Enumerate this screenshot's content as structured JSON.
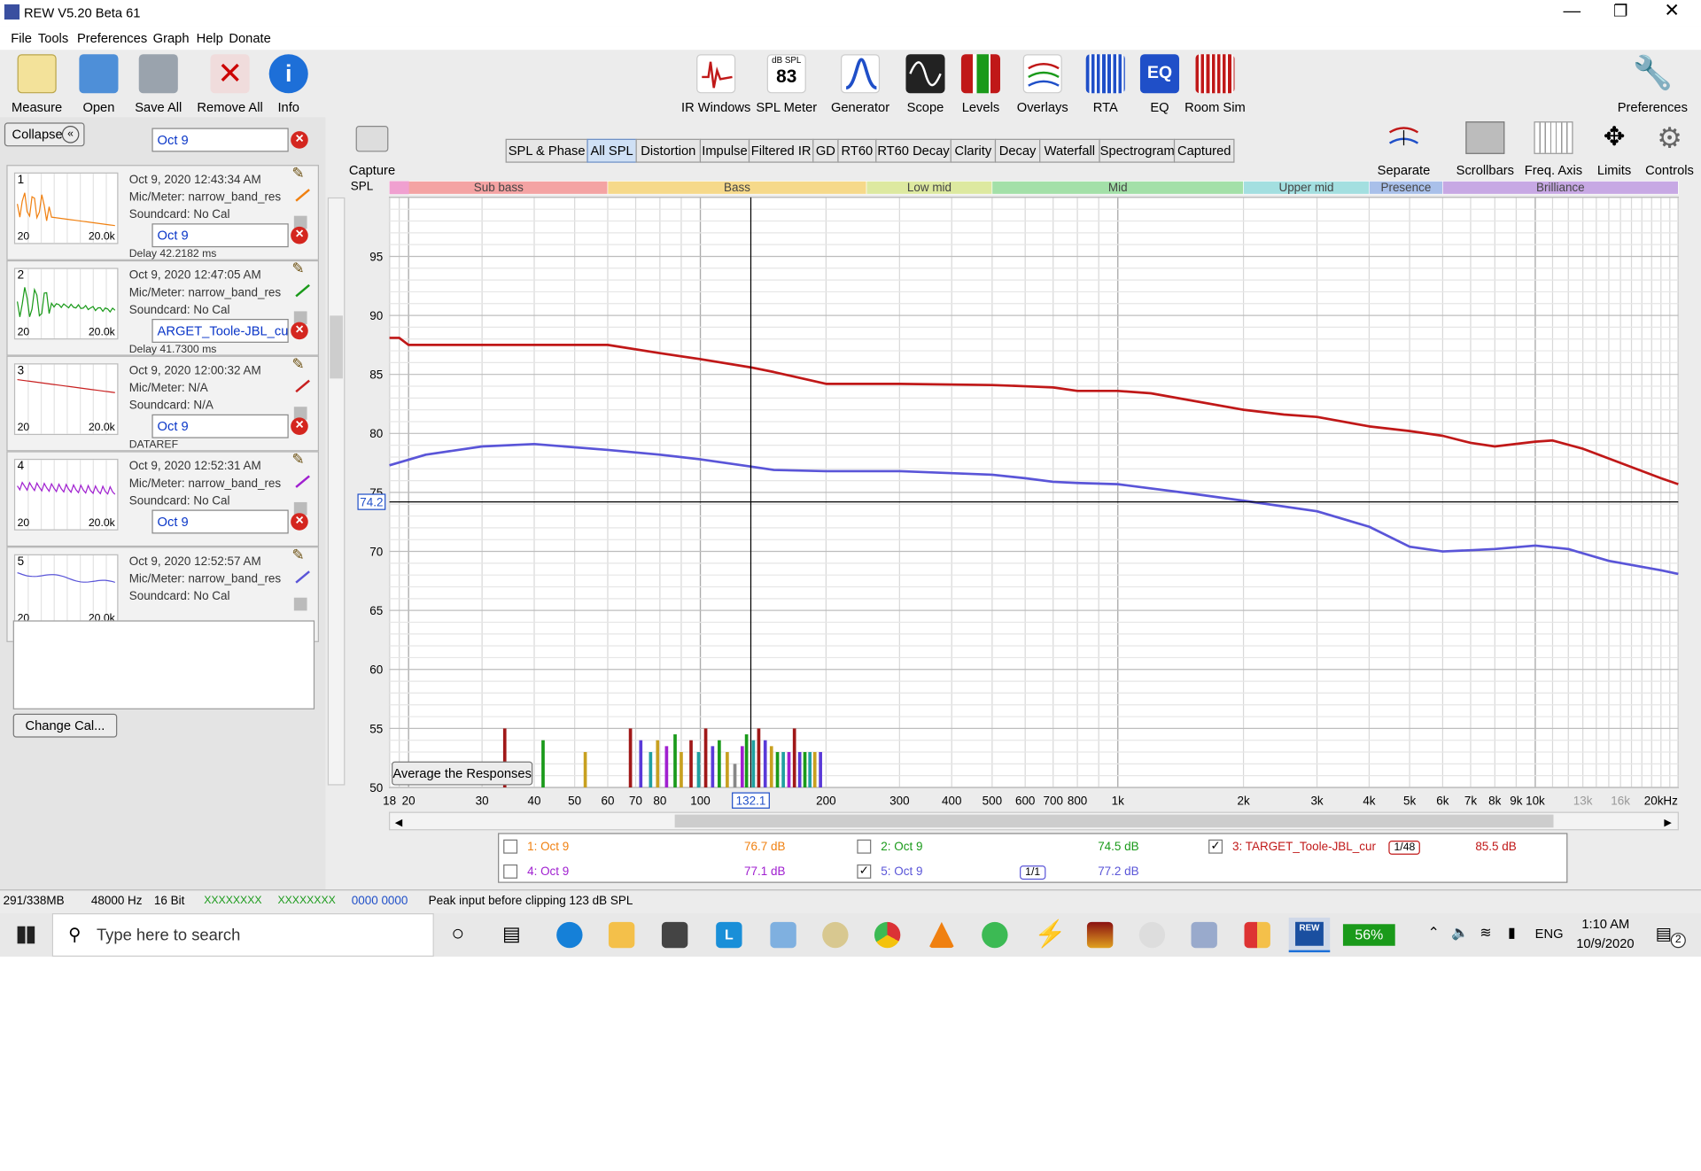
{
  "window": {
    "title": "REW V5.20 Beta 61"
  },
  "menu": [
    "File",
    "Tools",
    "Preferences",
    "Graph",
    "Help",
    "Donate"
  ],
  "toolbar": {
    "left": [
      "Measure",
      "Open",
      "Save All",
      "Remove All",
      "Info"
    ],
    "center": [
      "IR Windows",
      "SPL Meter",
      "Generator",
      "Scope",
      "Levels",
      "Overlays",
      "RTA",
      "EQ",
      "Room Sim"
    ],
    "spl_meter_top": "dB SPL",
    "spl_meter_value": "83",
    "right": "Preferences"
  },
  "left_panel": {
    "collapse": "Collapse",
    "measurements": [
      {
        "num": "1",
        "tab": "Oct 9",
        "date": "Oct 9, 2020 12:43:34 AM",
        "mic": "Mic/Meter: narrow_band_res",
        "sound": "Soundcard: No Cal",
        "f1": "20",
        "f2": "20.0k",
        "color": "#f08010",
        "extra": "Delay 42.2182 ms"
      },
      {
        "num": "2",
        "tab": "Oct 9",
        "date": "Oct 9, 2020 12:47:05 AM",
        "mic": "Mic/Meter: narrow_band_res",
        "sound": "Soundcard: No Cal",
        "f1": "20",
        "f2": "20.0k",
        "color": "#1a9a1a",
        "extra": "Delay 41.7300 ms"
      },
      {
        "num": "3",
        "tab": "ARGET_Toole-JBL_cur",
        "date": "Oct 9, 2020 12:00:32 AM",
        "mic": "Mic/Meter: N/A",
        "sound": "Soundcard: N/A",
        "f1": "20",
        "f2": "20.0k",
        "color": "#c82020",
        "extra": "DATAREF"
      },
      {
        "num": "4",
        "tab": "Oct 9",
        "date": "Oct 9, 2020 12:52:31 AM",
        "mic": "Mic/Meter: narrow_band_res",
        "sound": "Soundcard: No Cal",
        "f1": "20",
        "f2": "20.0k",
        "color": "#a020d0",
        "extra": ""
      },
      {
        "num": "5",
        "tab": "Oct 9",
        "date": "Oct 9, 2020 12:52:57 AM",
        "mic": "Mic/Meter: narrow_band_res",
        "sound": "Soundcard: No Cal",
        "f1": "20",
        "f2": "20.0k",
        "color": "#5a55d8",
        "extra": ""
      }
    ],
    "change_cal": "Change Cal..."
  },
  "capture": "Capture",
  "graph_tabs": [
    "SPL & Phase",
    "All SPL",
    "Distortion",
    "Impulse",
    "Filtered IR",
    "GD",
    "RT60",
    "RT60 Decay",
    "Clarity",
    "Decay",
    "Waterfall",
    "Spectrogram",
    "Captured"
  ],
  "selected_tab": "All SPL",
  "right_toolbar": [
    "Separate",
    "Scrollbars",
    "Freq. Axis",
    "Limits",
    "Controls"
  ],
  "chart_data": {
    "type": "line",
    "y_label": "SPL",
    "y_unit": "dB",
    "ylim": [
      50,
      100
    ],
    "y_ticks": [
      "95",
      "90",
      "85",
      "80",
      "75",
      "70",
      "65",
      "60",
      "55",
      "50"
    ],
    "x_log": true,
    "xlim": [
      18,
      22000
    ],
    "x_ticks": [
      [
        18,
        "18"
      ],
      [
        20,
        "20"
      ],
      [
        30,
        "30"
      ],
      [
        40,
        "40"
      ],
      [
        50,
        "50"
      ],
      [
        60,
        "60"
      ],
      [
        70,
        "70"
      ],
      [
        80,
        "80"
      ],
      [
        100,
        "100"
      ],
      [
        200,
        "200"
      ],
      [
        300,
        "300"
      ],
      [
        400,
        "400"
      ],
      [
        500,
        "500"
      ],
      [
        600,
        "600"
      ],
      [
        700,
        "700"
      ],
      [
        800,
        "800"
      ],
      [
        1000,
        "1k"
      ],
      [
        2000,
        "2k"
      ],
      [
        3000,
        "3k"
      ],
      [
        4000,
        "4k"
      ],
      [
        5000,
        "5k"
      ],
      [
        6000,
        "6k"
      ],
      [
        7000,
        "7k"
      ],
      [
        8000,
        "8k"
      ],
      [
        9000,
        "9k"
      ],
      [
        10000,
        "10k"
      ],
      [
        13000,
        "13k"
      ],
      [
        16000,
        "16k"
      ],
      [
        20000,
        "20kHz"
      ]
    ],
    "cursor_x": "132.1",
    "cursor_y": "74.2",
    "cursor_freq": 132.1,
    "cursor_spl": 74.2,
    "bands": [
      {
        "name": "Sub bass",
        "f0": 18,
        "f1": 60,
        "color": "#f4a3a3"
      },
      {
        "name": "Bass",
        "f0": 60,
        "f1": 250,
        "color": "#f6d98a"
      },
      {
        "name": "Low mid",
        "f0": 250,
        "f1": 500,
        "color": "#dde9a0"
      },
      {
        "name": "Mid",
        "f0": 500,
        "f1": 2000,
        "color": "#a3e0a8"
      },
      {
        "name": "Upper mid",
        "f0": 2000,
        "f1": 4000,
        "color": "#a3dfe0"
      },
      {
        "name": "Presence",
        "f0": 4000,
        "f1": 6000,
        "color": "#a9c0ea"
      },
      {
        "name": "Brilliance",
        "f0": 6000,
        "f1": 22000,
        "color": "#c7a8e4"
      }
    ],
    "series": [
      {
        "name": "3: TARGET_Toole-JBL_cur",
        "color": "#c01818",
        "x": [
          18,
          19,
          20,
          30,
          60,
          80,
          100,
          132,
          150,
          200,
          300,
          500,
          600,
          700,
          800,
          1000,
          1200,
          2000,
          2500,
          3000,
          4000,
          5000,
          6000,
          7000,
          8000,
          10000,
          11000,
          13000,
          16000,
          20000,
          22000
        ],
        "y": [
          88.1,
          88.1,
          87.5,
          87.5,
          87.5,
          86.8,
          86.3,
          85.6,
          85.2,
          84.2,
          84.2,
          84.1,
          84.0,
          83.9,
          83.6,
          83.6,
          83.4,
          82.0,
          81.6,
          81.4,
          80.6,
          80.2,
          79.8,
          79.2,
          78.9,
          79.3,
          79.4,
          78.7,
          77.5,
          76.2,
          75.7
        ]
      },
      {
        "name": "5: Oct 9",
        "color": "#5a55d8",
        "x": [
          18,
          22,
          30,
          40,
          60,
          80,
          100,
          132,
          150,
          200,
          300,
          500,
          600,
          700,
          800,
          1000,
          1500,
          2000,
          3000,
          4000,
          5000,
          6000,
          7000,
          8000,
          10000,
          12000,
          15000,
          20000,
          22000
        ],
        "y": [
          77.3,
          78.2,
          78.9,
          79.1,
          78.6,
          78.2,
          77.8,
          77.2,
          76.9,
          76.8,
          76.8,
          76.5,
          76.2,
          75.9,
          75.8,
          75.7,
          74.9,
          74.3,
          73.4,
          72.1,
          70.4,
          70.0,
          70.1,
          70.2,
          70.5,
          70.2,
          69.2,
          68.4,
          68.1
        ]
      }
    ],
    "bars": [
      {
        "f": 34,
        "h": 55,
        "c": "#a01818"
      },
      {
        "f": 42,
        "h": 54,
        "c": "#1a9a1a"
      },
      {
        "f": 53,
        "h": 53,
        "c": "#c8a020"
      },
      {
        "f": 68,
        "h": 55,
        "c": "#a01818"
      },
      {
        "f": 72,
        "h": 54,
        "c": "#5a3ad8"
      },
      {
        "f": 76,
        "h": 53,
        "c": "#20a0a0"
      },
      {
        "f": 79,
        "h": 54,
        "c": "#c8a020"
      },
      {
        "f": 83,
        "h": 53.5,
        "c": "#a020d0"
      },
      {
        "f": 87,
        "h": 54.5,
        "c": "#1a9a1a"
      },
      {
        "f": 90,
        "h": 53,
        "c": "#c8a020"
      },
      {
        "f": 95,
        "h": 54,
        "c": "#a01818"
      },
      {
        "f": 99,
        "h": 53,
        "c": "#20a0a0"
      },
      {
        "f": 103,
        "h": 55,
        "c": "#a01818"
      },
      {
        "f": 107,
        "h": 53.5,
        "c": "#5a3ad8"
      },
      {
        "f": 111,
        "h": 54,
        "c": "#1a9a1a"
      },
      {
        "f": 116,
        "h": 53,
        "c": "#c8a020"
      },
      {
        "f": 121,
        "h": 52,
        "c": "#888888"
      },
      {
        "f": 126,
        "h": 53.5,
        "c": "#a020d0"
      },
      {
        "f": 129,
        "h": 54.5,
        "c": "#1a9a1a"
      },
      {
        "f": 134,
        "h": 54,
        "c": "#20a0a0"
      },
      {
        "f": 138,
        "h": 55,
        "c": "#a01818"
      },
      {
        "f": 143,
        "h": 54,
        "c": "#5a3ad8"
      },
      {
        "f": 148,
        "h": 53.5,
        "c": "#c8a020"
      },
      {
        "f": 153,
        "h": 53,
        "c": "#1a9a1a"
      },
      {
        "f": 158,
        "h": 53,
        "c": "#20a0a0"
      },
      {
        "f": 163,
        "h": 53,
        "c": "#a020d0"
      },
      {
        "f": 168,
        "h": 55,
        "c": "#a01818"
      },
      {
        "f": 173,
        "h": 53,
        "c": "#5a3ad8"
      },
      {
        "f": 178,
        "h": 53,
        "c": "#1a9a1a"
      },
      {
        "f": 183,
        "h": 53,
        "c": "#20a0a0"
      },
      {
        "f": 188,
        "h": 53,
        "c": "#c8a020"
      },
      {
        "f": 194,
        "h": 53,
        "c": "#5a3ad8"
      }
    ],
    "avg_button": "Average the Responses"
  },
  "legend": [
    {
      "label": "1: Oct 9",
      "value": "76.7 dB",
      "color": "#f08010",
      "checked": ""
    },
    {
      "label": "2: Oct 9",
      "value": "74.5 dB",
      "color": "#1a9a1a",
      "checked": ""
    },
    {
      "label": "3: TARGET_Toole-JBL_cur",
      "value": "85.5 dB",
      "color": "#c01818",
      "checked": "✓",
      "smooth": "1/48"
    },
    {
      "label": "4: Oct 9",
      "value": "77.1 dB",
      "color": "#a020d0",
      "checked": ""
    },
    {
      "label": "5: Oct 9",
      "value": "77.2 dB",
      "color": "#5a55d8",
      "checked": "✓",
      "smooth": "1/1"
    }
  ],
  "status": {
    "mem": "291/338MB",
    "rate": "48000 Hz",
    "bits": "16 Bit",
    "ind1": "XXXXXXXX",
    "ind2": "XXXXXXXX",
    "ind3": "0000 0000",
    "peak": "Peak input before clipping 123 dB SPL"
  },
  "taskbar": {
    "search": "Type here to search",
    "battery": "56%",
    "lang": "ENG",
    "time": "1:10 AM",
    "date": "10/9/2020",
    "notif": "2",
    "rew": "REW"
  }
}
